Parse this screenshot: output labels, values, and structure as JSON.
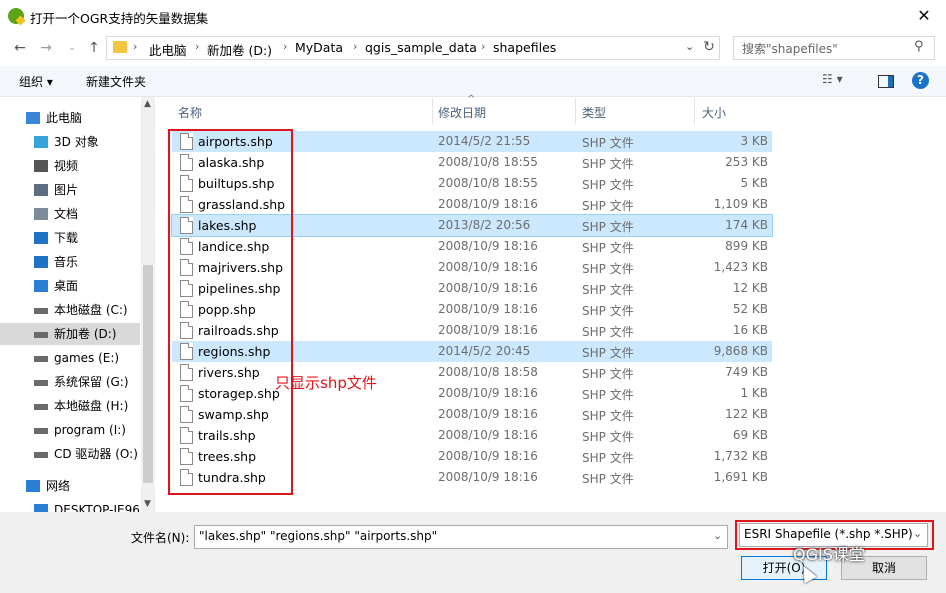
{
  "window": {
    "title": "打开一个OGR支持的矢量数据集"
  },
  "address": {
    "crumbs": [
      "此电脑",
      "新加卷 (D:)",
      "MyData",
      "qgis_sample_data",
      "shapefiles"
    ],
    "search_placeholder": "搜索\"shapefiles\""
  },
  "toolbar": {
    "organize": "组织 ▾",
    "new_folder": "新建文件夹"
  },
  "nav": {
    "items": [
      {
        "label": "此电脑",
        "icon": "computer-icon"
      },
      {
        "label": "3D 对象",
        "icon": "cube-icon"
      },
      {
        "label": "视频",
        "icon": "video-icon"
      },
      {
        "label": "图片",
        "icon": "picture-icon"
      },
      {
        "label": "文档",
        "icon": "document-icon"
      },
      {
        "label": "下载",
        "icon": "download-icon"
      },
      {
        "label": "音乐",
        "icon": "music-icon"
      },
      {
        "label": "桌面",
        "icon": "desktop-icon"
      },
      {
        "label": "本地磁盘 (C:)",
        "icon": "windows-drive-icon"
      },
      {
        "label": "新加卷 (D:)",
        "icon": "drive-icon",
        "selected": true
      },
      {
        "label": "games (E:)",
        "icon": "drive-icon"
      },
      {
        "label": "系统保留 (G:)",
        "icon": "drive-icon"
      },
      {
        "label": "本地磁盘 (H:)",
        "icon": "drive-icon"
      },
      {
        "label": "program (I:)",
        "icon": "drive-icon"
      },
      {
        "label": "CD 驱动器 (O:)",
        "icon": "cd-drive-icon"
      },
      {
        "label": "网络",
        "icon": "network-icon"
      },
      {
        "label": "DESKTOP-IE96",
        "icon": "network-pc-icon"
      }
    ]
  },
  "columns": {
    "name": "名称",
    "date": "修改日期",
    "type": "类型",
    "size": "大小"
  },
  "files": [
    {
      "name": "airports.shp",
      "date": "2014/5/2 21:55",
      "type": "SHP 文件",
      "size": "3 KB",
      "selected": true
    },
    {
      "name": "alaska.shp",
      "date": "2008/10/8 18:55",
      "type": "SHP 文件",
      "size": "253 KB"
    },
    {
      "name": "builtups.shp",
      "date": "2008/10/8 18:55",
      "type": "SHP 文件",
      "size": "5 KB"
    },
    {
      "name": "grassland.shp",
      "date": "2008/10/9 18:16",
      "type": "SHP 文件",
      "size": "1,109 KB"
    },
    {
      "name": "lakes.shp",
      "date": "2013/8/2 20:56",
      "type": "SHP 文件",
      "size": "174 KB",
      "selected": true,
      "focused": true
    },
    {
      "name": "landice.shp",
      "date": "2008/10/9 18:16",
      "type": "SHP 文件",
      "size": "899 KB"
    },
    {
      "name": "majrivers.shp",
      "date": "2008/10/9 18:16",
      "type": "SHP 文件",
      "size": "1,423 KB"
    },
    {
      "name": "pipelines.shp",
      "date": "2008/10/9 18:16",
      "type": "SHP 文件",
      "size": "12 KB"
    },
    {
      "name": "popp.shp",
      "date": "2008/10/9 18:16",
      "type": "SHP 文件",
      "size": "52 KB"
    },
    {
      "name": "railroads.shp",
      "date": "2008/10/9 18:16",
      "type": "SHP 文件",
      "size": "16 KB"
    },
    {
      "name": "regions.shp",
      "date": "2014/5/2 20:45",
      "type": "SHP 文件",
      "size": "9,868 KB",
      "selected": true
    },
    {
      "name": "rivers.shp",
      "date": "2008/10/8 18:58",
      "type": "SHP 文件",
      "size": "749 KB"
    },
    {
      "name": "storagep.shp",
      "date": "2008/10/9 18:16",
      "type": "SHP 文件",
      "size": "1 KB"
    },
    {
      "name": "swamp.shp",
      "date": "2008/10/9 18:16",
      "type": "SHP 文件",
      "size": "122 KB"
    },
    {
      "name": "trails.shp",
      "date": "2008/10/9 18:16",
      "type": "SHP 文件",
      "size": "69 KB"
    },
    {
      "name": "trees.shp",
      "date": "2008/10/9 18:16",
      "type": "SHP 文件",
      "size": "1,732 KB"
    },
    {
      "name": "tundra.shp",
      "date": "2008/10/9 18:16",
      "type": "SHP 文件",
      "size": "1,691 KB"
    }
  ],
  "annotation": {
    "text": "只显示shp文件",
    "color": "#e0141b"
  },
  "bottom": {
    "filename_label": "文件名(N):",
    "filename_value": "\"lakes.shp\" \"regions.shp\" \"airports.shp\"",
    "filter_value": "ESRI Shapefile (*.shp *.SHP)",
    "open_label": "打开(O)",
    "cancel_label": "取消"
  },
  "watermark": "QGIS课堂"
}
